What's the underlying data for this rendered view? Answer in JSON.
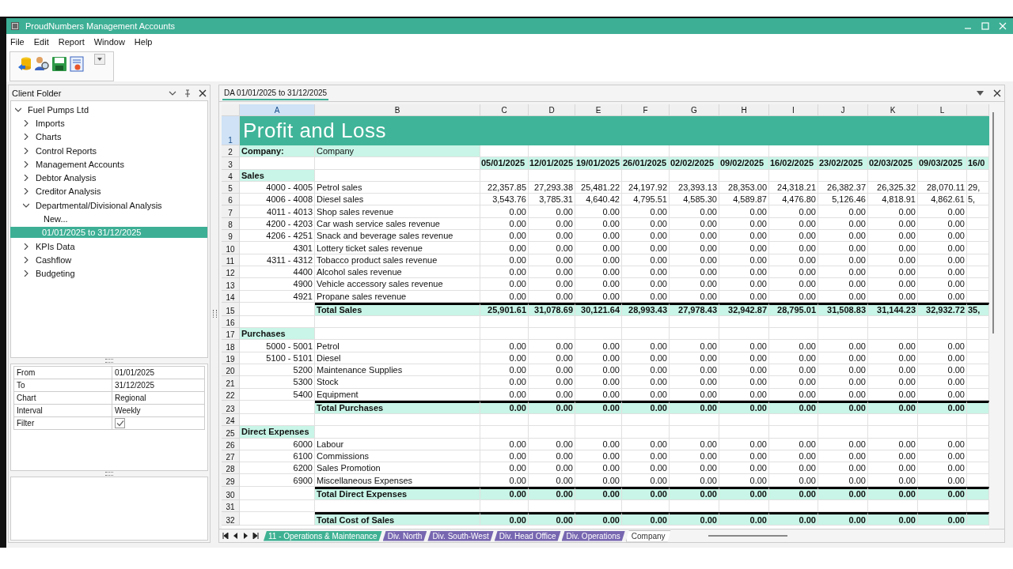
{
  "window": {
    "title": "ProudNumbers Management Accounts"
  },
  "menu": [
    "File",
    "Edit",
    "Report",
    "Window",
    "Help"
  ],
  "client_folder": {
    "title": "Client Folder",
    "tree": [
      {
        "label": "Fuel Pumps Ltd",
        "expanded": true,
        "selected": false,
        "children": [
          {
            "label": "Imports",
            "expanded": false,
            "selected": false
          },
          {
            "label": "Charts",
            "expanded": false,
            "selected": false
          },
          {
            "label": "Control Reports",
            "expanded": false,
            "selected": false
          },
          {
            "label": "Management Accounts",
            "expanded": false,
            "selected": false
          },
          {
            "label": "Debtor Analysis",
            "expanded": false,
            "selected": false
          },
          {
            "label": "Creditor Analysis",
            "expanded": false,
            "selected": false
          },
          {
            "label": "Departmental/Divisional Analysis",
            "expanded": true,
            "selected": false,
            "children": [
              {
                "label": "New...",
                "selected": false
              },
              {
                "label": "01/01/2025 to 31/12/2025",
                "selected": true
              }
            ]
          },
          {
            "label": "KPIs Data",
            "expanded": false,
            "selected": false
          },
          {
            "label": "Cashflow",
            "expanded": false,
            "selected": false
          },
          {
            "label": "Budgeting",
            "expanded": false,
            "selected": false
          }
        ]
      }
    ]
  },
  "properties": [
    {
      "kind": "text",
      "label": "From",
      "value": "01/01/2025"
    },
    {
      "kind": "text",
      "label": "To",
      "value": "31/12/2025"
    },
    {
      "kind": "text",
      "label": "Chart",
      "value": "Regional"
    },
    {
      "kind": "text",
      "label": "Interval",
      "value": "Weekly"
    },
    {
      "kind": "checkbox",
      "label": "Filter",
      "checked": true
    }
  ],
  "document": {
    "tab": "DA 01/01/2025 to 31/12/2025",
    "columns": [
      {
        "letter": "A",
        "selected": true
      },
      {
        "letter": "B",
        "selected": false
      },
      {
        "letter": "C",
        "selected": false
      },
      {
        "letter": "D",
        "selected": false
      },
      {
        "letter": "E",
        "selected": false
      },
      {
        "letter": "F",
        "selected": false
      },
      {
        "letter": "G",
        "selected": false
      },
      {
        "letter": "H",
        "selected": false
      },
      {
        "letter": "I",
        "selected": false
      },
      {
        "letter": "J",
        "selected": false
      },
      {
        "letter": "K",
        "selected": false
      },
      {
        "letter": "L",
        "selected": false
      }
    ],
    "rows": [
      {
        "n": "1",
        "kind": "title",
        "selected": true,
        "title": "Profit and Loss"
      },
      {
        "n": "2",
        "kind": "company",
        "selected": false,
        "code": "Company:",
        "label": "Company"
      },
      {
        "n": "3",
        "kind": "dates",
        "selected": false,
        "values": [
          "05/01/2025",
          "12/01/2025",
          "19/01/2025",
          "26/01/2025",
          "02/02/2025",
          "09/02/2025",
          "16/02/2025",
          "23/02/2025",
          "02/03/2025",
          "09/03/2025",
          "16/0"
        ]
      },
      {
        "n": "4",
        "kind": "section",
        "selected": false,
        "code": "Sales"
      },
      {
        "n": "5",
        "kind": "line",
        "selected": false,
        "code": "4000 - 4005",
        "label": "Petrol sales",
        "values": [
          "22,357.85",
          "27,293.38",
          "25,481.22",
          "24,197.92",
          "23,393.13",
          "28,353.00",
          "24,318.21",
          "26,382.37",
          "26,325.32",
          "28,070.11",
          "29,"
        ]
      },
      {
        "n": "6",
        "kind": "line",
        "selected": false,
        "code": "4006 - 4008",
        "label": "Diesel sales",
        "values": [
          "3,543.76",
          "3,785.31",
          "4,640.42",
          "4,795.51",
          "4,585.30",
          "4,589.87",
          "4,476.80",
          "5,126.46",
          "4,818.91",
          "4,862.61",
          "5,"
        ]
      },
      {
        "n": "7",
        "kind": "line",
        "selected": false,
        "code": "4011 - 4013",
        "label": "Shop sales revenue",
        "values": [
          "0.00",
          "0.00",
          "0.00",
          "0.00",
          "0.00",
          "0.00",
          "0.00",
          "0.00",
          "0.00",
          "0.00"
        ]
      },
      {
        "n": "8",
        "kind": "line",
        "selected": false,
        "code": "4200 - 4203",
        "label": "Car wash service sales revenue",
        "values": [
          "0.00",
          "0.00",
          "0.00",
          "0.00",
          "0.00",
          "0.00",
          "0.00",
          "0.00",
          "0.00",
          "0.00"
        ]
      },
      {
        "n": "9",
        "kind": "line",
        "selected": false,
        "code": "4206 - 4251",
        "label": "Snack and beverage sales revenue",
        "values": [
          "0.00",
          "0.00",
          "0.00",
          "0.00",
          "0.00",
          "0.00",
          "0.00",
          "0.00",
          "0.00",
          "0.00"
        ]
      },
      {
        "n": "10",
        "kind": "line",
        "selected": false,
        "code": "4301",
        "label": "Lottery ticket sales revenue",
        "values": [
          "0.00",
          "0.00",
          "0.00",
          "0.00",
          "0.00",
          "0.00",
          "0.00",
          "0.00",
          "0.00",
          "0.00"
        ]
      },
      {
        "n": "11",
        "kind": "line",
        "selected": false,
        "code": "4311 - 4312",
        "label": "Tobacco product sales revenue",
        "values": [
          "0.00",
          "0.00",
          "0.00",
          "0.00",
          "0.00",
          "0.00",
          "0.00",
          "0.00",
          "0.00",
          "0.00"
        ]
      },
      {
        "n": "12",
        "kind": "line",
        "selected": false,
        "code": "4400",
        "label": "Alcohol sales revenue",
        "values": [
          "0.00",
          "0.00",
          "0.00",
          "0.00",
          "0.00",
          "0.00",
          "0.00",
          "0.00",
          "0.00",
          "0.00"
        ]
      },
      {
        "n": "13",
        "kind": "line",
        "selected": false,
        "code": "4900",
        "label": "Vehicle accessory sales revenue",
        "values": [
          "0.00",
          "0.00",
          "0.00",
          "0.00",
          "0.00",
          "0.00",
          "0.00",
          "0.00",
          "0.00",
          "0.00"
        ]
      },
      {
        "n": "14",
        "kind": "line",
        "selected": false,
        "code": "4921",
        "label": "Propane sales revenue",
        "values": [
          "0.00",
          "0.00",
          "0.00",
          "0.00",
          "0.00",
          "0.00",
          "0.00",
          "0.00",
          "0.00",
          "0.00"
        ]
      },
      {
        "n": "15",
        "kind": "total",
        "selected": false,
        "label": "Total Sales",
        "values": [
          "25,901.61",
          "31,078.69",
          "30,121.64",
          "28,993.43",
          "27,978.43",
          "32,942.87",
          "28,795.01",
          "31,508.83",
          "31,144.23",
          "32,932.72",
          "35,"
        ]
      },
      {
        "n": "16",
        "kind": "blank",
        "selected": false
      },
      {
        "n": "17",
        "kind": "section",
        "selected": false,
        "code": "Purchases"
      },
      {
        "n": "18",
        "kind": "line",
        "selected": false,
        "code": "5000 - 5001",
        "label": "Petrol",
        "values": [
          "0.00",
          "0.00",
          "0.00",
          "0.00",
          "0.00",
          "0.00",
          "0.00",
          "0.00",
          "0.00",
          "0.00"
        ]
      },
      {
        "n": "19",
        "kind": "line",
        "selected": false,
        "code": "5100 - 5101",
        "label": "Diesel",
        "values": [
          "0.00",
          "0.00",
          "0.00",
          "0.00",
          "0.00",
          "0.00",
          "0.00",
          "0.00",
          "0.00",
          "0.00"
        ]
      },
      {
        "n": "20",
        "kind": "line",
        "selected": false,
        "code": "5200",
        "label": "Maintenance Supplies",
        "values": [
          "0.00",
          "0.00",
          "0.00",
          "0.00",
          "0.00",
          "0.00",
          "0.00",
          "0.00",
          "0.00",
          "0.00"
        ]
      },
      {
        "n": "21",
        "kind": "line",
        "selected": false,
        "code": "5300",
        "label": "Stock",
        "values": [
          "0.00",
          "0.00",
          "0.00",
          "0.00",
          "0.00",
          "0.00",
          "0.00",
          "0.00",
          "0.00",
          "0.00"
        ]
      },
      {
        "n": "22",
        "kind": "line",
        "selected": false,
        "code": "5400",
        "label": "Equipment",
        "values": [
          "0.00",
          "0.00",
          "0.00",
          "0.00",
          "0.00",
          "0.00",
          "0.00",
          "0.00",
          "0.00",
          "0.00"
        ]
      },
      {
        "n": "23",
        "kind": "total",
        "selected": false,
        "label": "Total Purchases",
        "values": [
          "0.00",
          "0.00",
          "0.00",
          "0.00",
          "0.00",
          "0.00",
          "0.00",
          "0.00",
          "0.00",
          "0.00"
        ]
      },
      {
        "n": "24",
        "kind": "blank",
        "selected": false
      },
      {
        "n": "25",
        "kind": "section",
        "selected": false,
        "code": "Direct Expenses"
      },
      {
        "n": "26",
        "kind": "line",
        "selected": false,
        "code": "6000",
        "label": "Labour",
        "values": [
          "0.00",
          "0.00",
          "0.00",
          "0.00",
          "0.00",
          "0.00",
          "0.00",
          "0.00",
          "0.00",
          "0.00"
        ]
      },
      {
        "n": "27",
        "kind": "line",
        "selected": false,
        "code": "6100",
        "label": "Commissions",
        "values": [
          "0.00",
          "0.00",
          "0.00",
          "0.00",
          "0.00",
          "0.00",
          "0.00",
          "0.00",
          "0.00",
          "0.00"
        ]
      },
      {
        "n": "28",
        "kind": "line",
        "selected": false,
        "code": "6200",
        "label": "Sales Promotion",
        "values": [
          "0.00",
          "0.00",
          "0.00",
          "0.00",
          "0.00",
          "0.00",
          "0.00",
          "0.00",
          "0.00",
          "0.00"
        ]
      },
      {
        "n": "29",
        "kind": "line",
        "selected": false,
        "code": "6900",
        "label": "Miscellaneous Expenses",
        "values": [
          "0.00",
          "0.00",
          "0.00",
          "0.00",
          "0.00",
          "0.00",
          "0.00",
          "0.00",
          "0.00",
          "0.00"
        ]
      },
      {
        "n": "30",
        "kind": "total",
        "selected": false,
        "label": "Total Direct Expenses",
        "values": [
          "0.00",
          "0.00",
          "0.00",
          "0.00",
          "0.00",
          "0.00",
          "0.00",
          "0.00",
          "0.00",
          "0.00"
        ]
      },
      {
        "n": "31",
        "kind": "blank",
        "selected": false
      },
      {
        "n": "32",
        "kind": "total",
        "selected": false,
        "label": "Total Cost of Sales",
        "values": [
          "0.00",
          "0.00",
          "0.00",
          "0.00",
          "0.00",
          "0.00",
          "0.00",
          "0.00",
          "0.00",
          "0.00"
        ]
      }
    ],
    "sheet_tabs": [
      {
        "label": "11 - Operations & Maintenance",
        "color": "#3fb193",
        "selected": false
      },
      {
        "label": "Div. North",
        "color": "#7766b0",
        "selected": false
      },
      {
        "label": "Div. South-West",
        "color": "#7766b0",
        "selected": false
      },
      {
        "label": "Div. Head Office",
        "color": "#7766b0",
        "selected": false
      },
      {
        "label": "Div. Operations",
        "color": "#7766b0",
        "selected": false
      },
      {
        "label": "Company",
        "selected": true
      }
    ]
  }
}
